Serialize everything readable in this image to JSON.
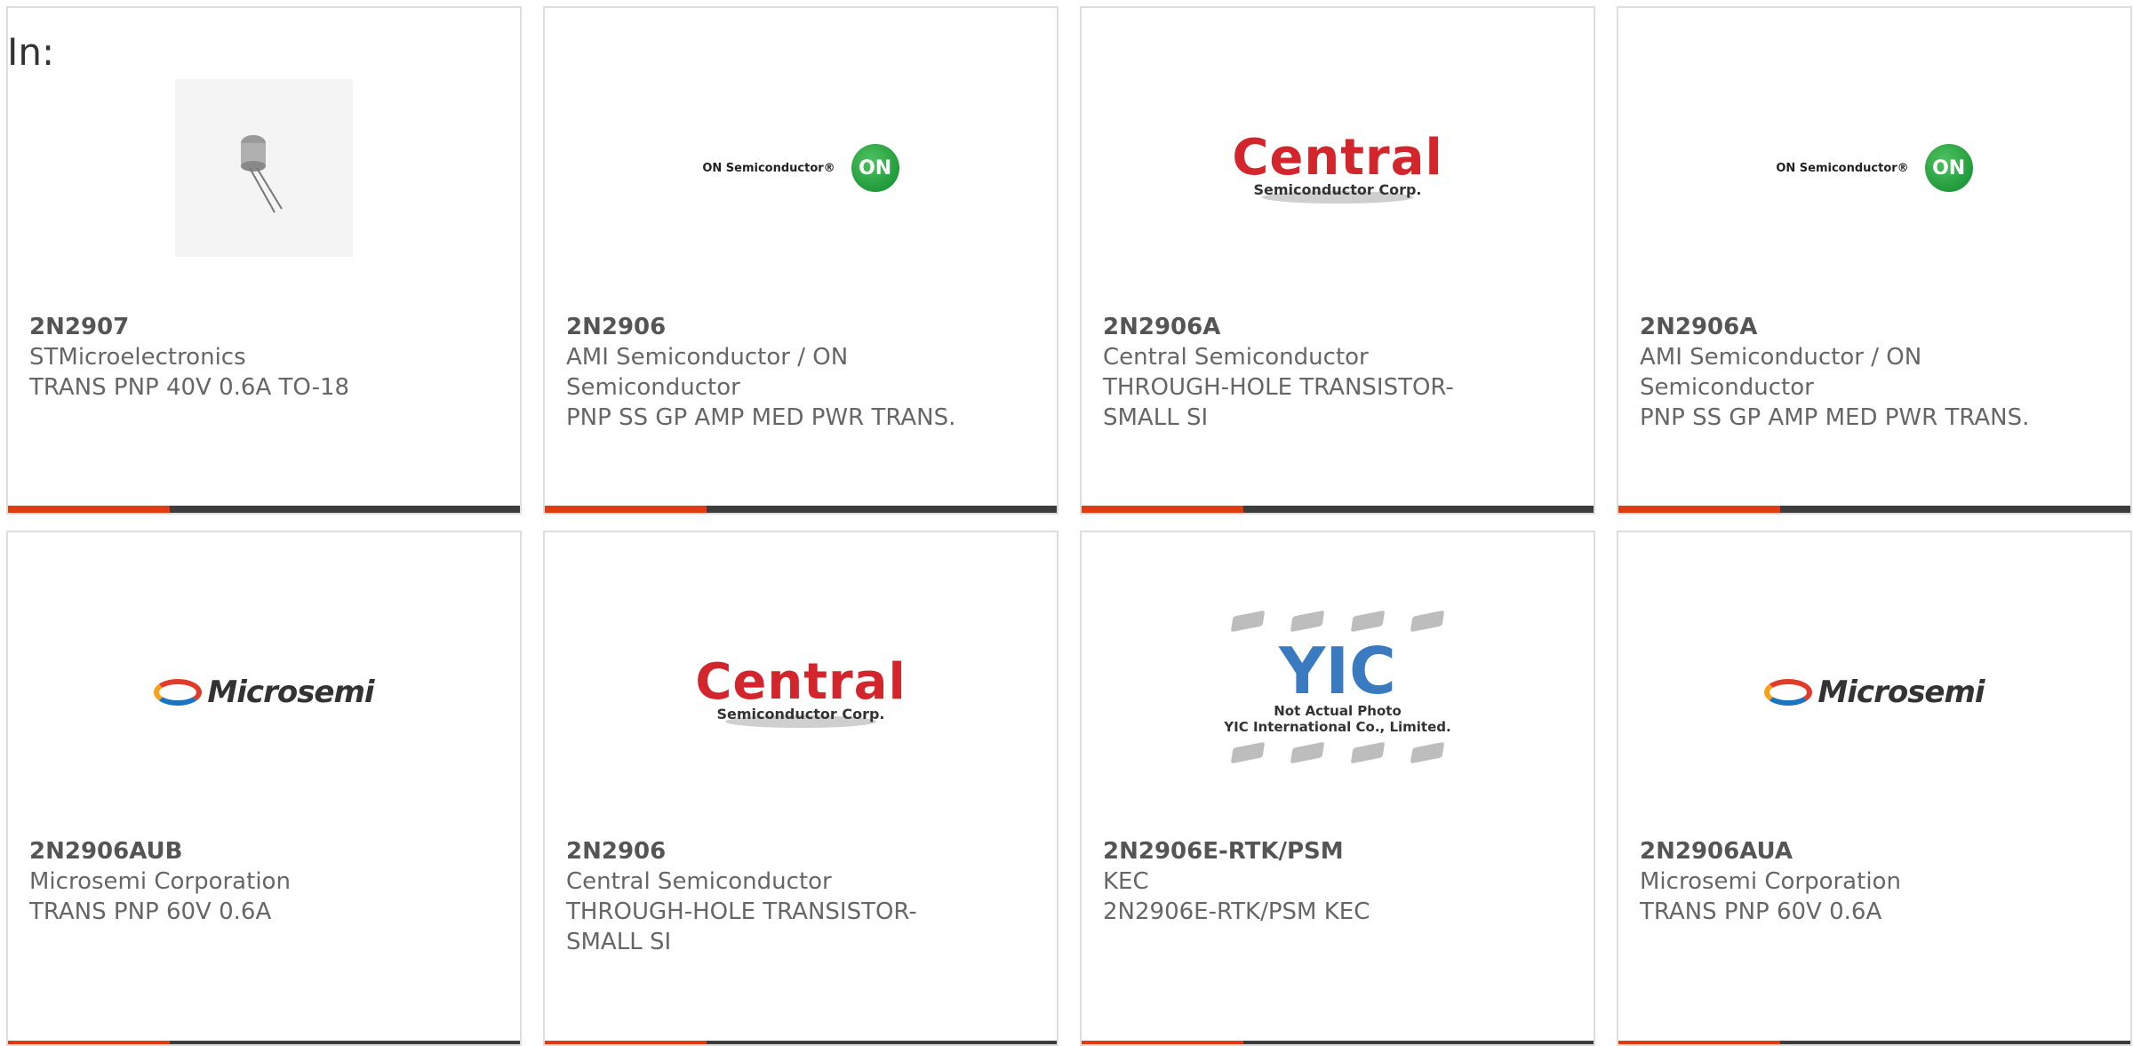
{
  "filter_label": "In:",
  "colors": {
    "accent": "#e23b0f",
    "bar": "#3c3c3c",
    "border": "#dedede"
  },
  "logos": {
    "onsemi_text": "ON Semiconductor®",
    "onsemi_mark": "ON",
    "central_big": "Central",
    "central_small": "Semiconductor Corp.",
    "microsemi_text": "Microsemi",
    "yic_mark": "YIC",
    "yic_note1": "Not Actual Photo",
    "yic_note2": "YIC International Co., Limited."
  },
  "cards": [
    {
      "image": "transistor-photo",
      "part": "2N2907",
      "maker": "STMicroelectronics",
      "desc": "TRANS PNP 40V 0.6A TO-18"
    },
    {
      "image": "onsemi-logo",
      "part": "2N2906",
      "maker": "AMI Semiconductor / ON Semiconductor",
      "desc": "PNP SS GP AMP MED PWR TRANS."
    },
    {
      "image": "central-logo",
      "part": "2N2906A",
      "maker": "Central Semiconductor",
      "desc": "THROUGH-HOLE TRANSISTOR-SMALL SI"
    },
    {
      "image": "onsemi-logo",
      "part": "2N2906A",
      "maker": "AMI Semiconductor / ON Semiconductor",
      "desc": "PNP SS GP AMP MED PWR TRANS."
    },
    {
      "image": "microsemi-logo",
      "part": "2N2906AUB",
      "maker": "Microsemi Corporation",
      "desc": "TRANS PNP 60V 0.6A"
    },
    {
      "image": "central-logo",
      "part": "2N2906",
      "maker": "Central Semiconductor",
      "desc": "THROUGH-HOLE TRANSISTOR-SMALL SI"
    },
    {
      "image": "yic-placeholder",
      "part": "2N2906E-RTK/PSM",
      "maker": "KEC",
      "desc": "2N2906E-RTK/PSM KEC"
    },
    {
      "image": "microsemi-logo",
      "part": "2N2906AUA",
      "maker": "Microsemi Corporation",
      "desc": "TRANS PNP 60V 0.6A"
    }
  ]
}
